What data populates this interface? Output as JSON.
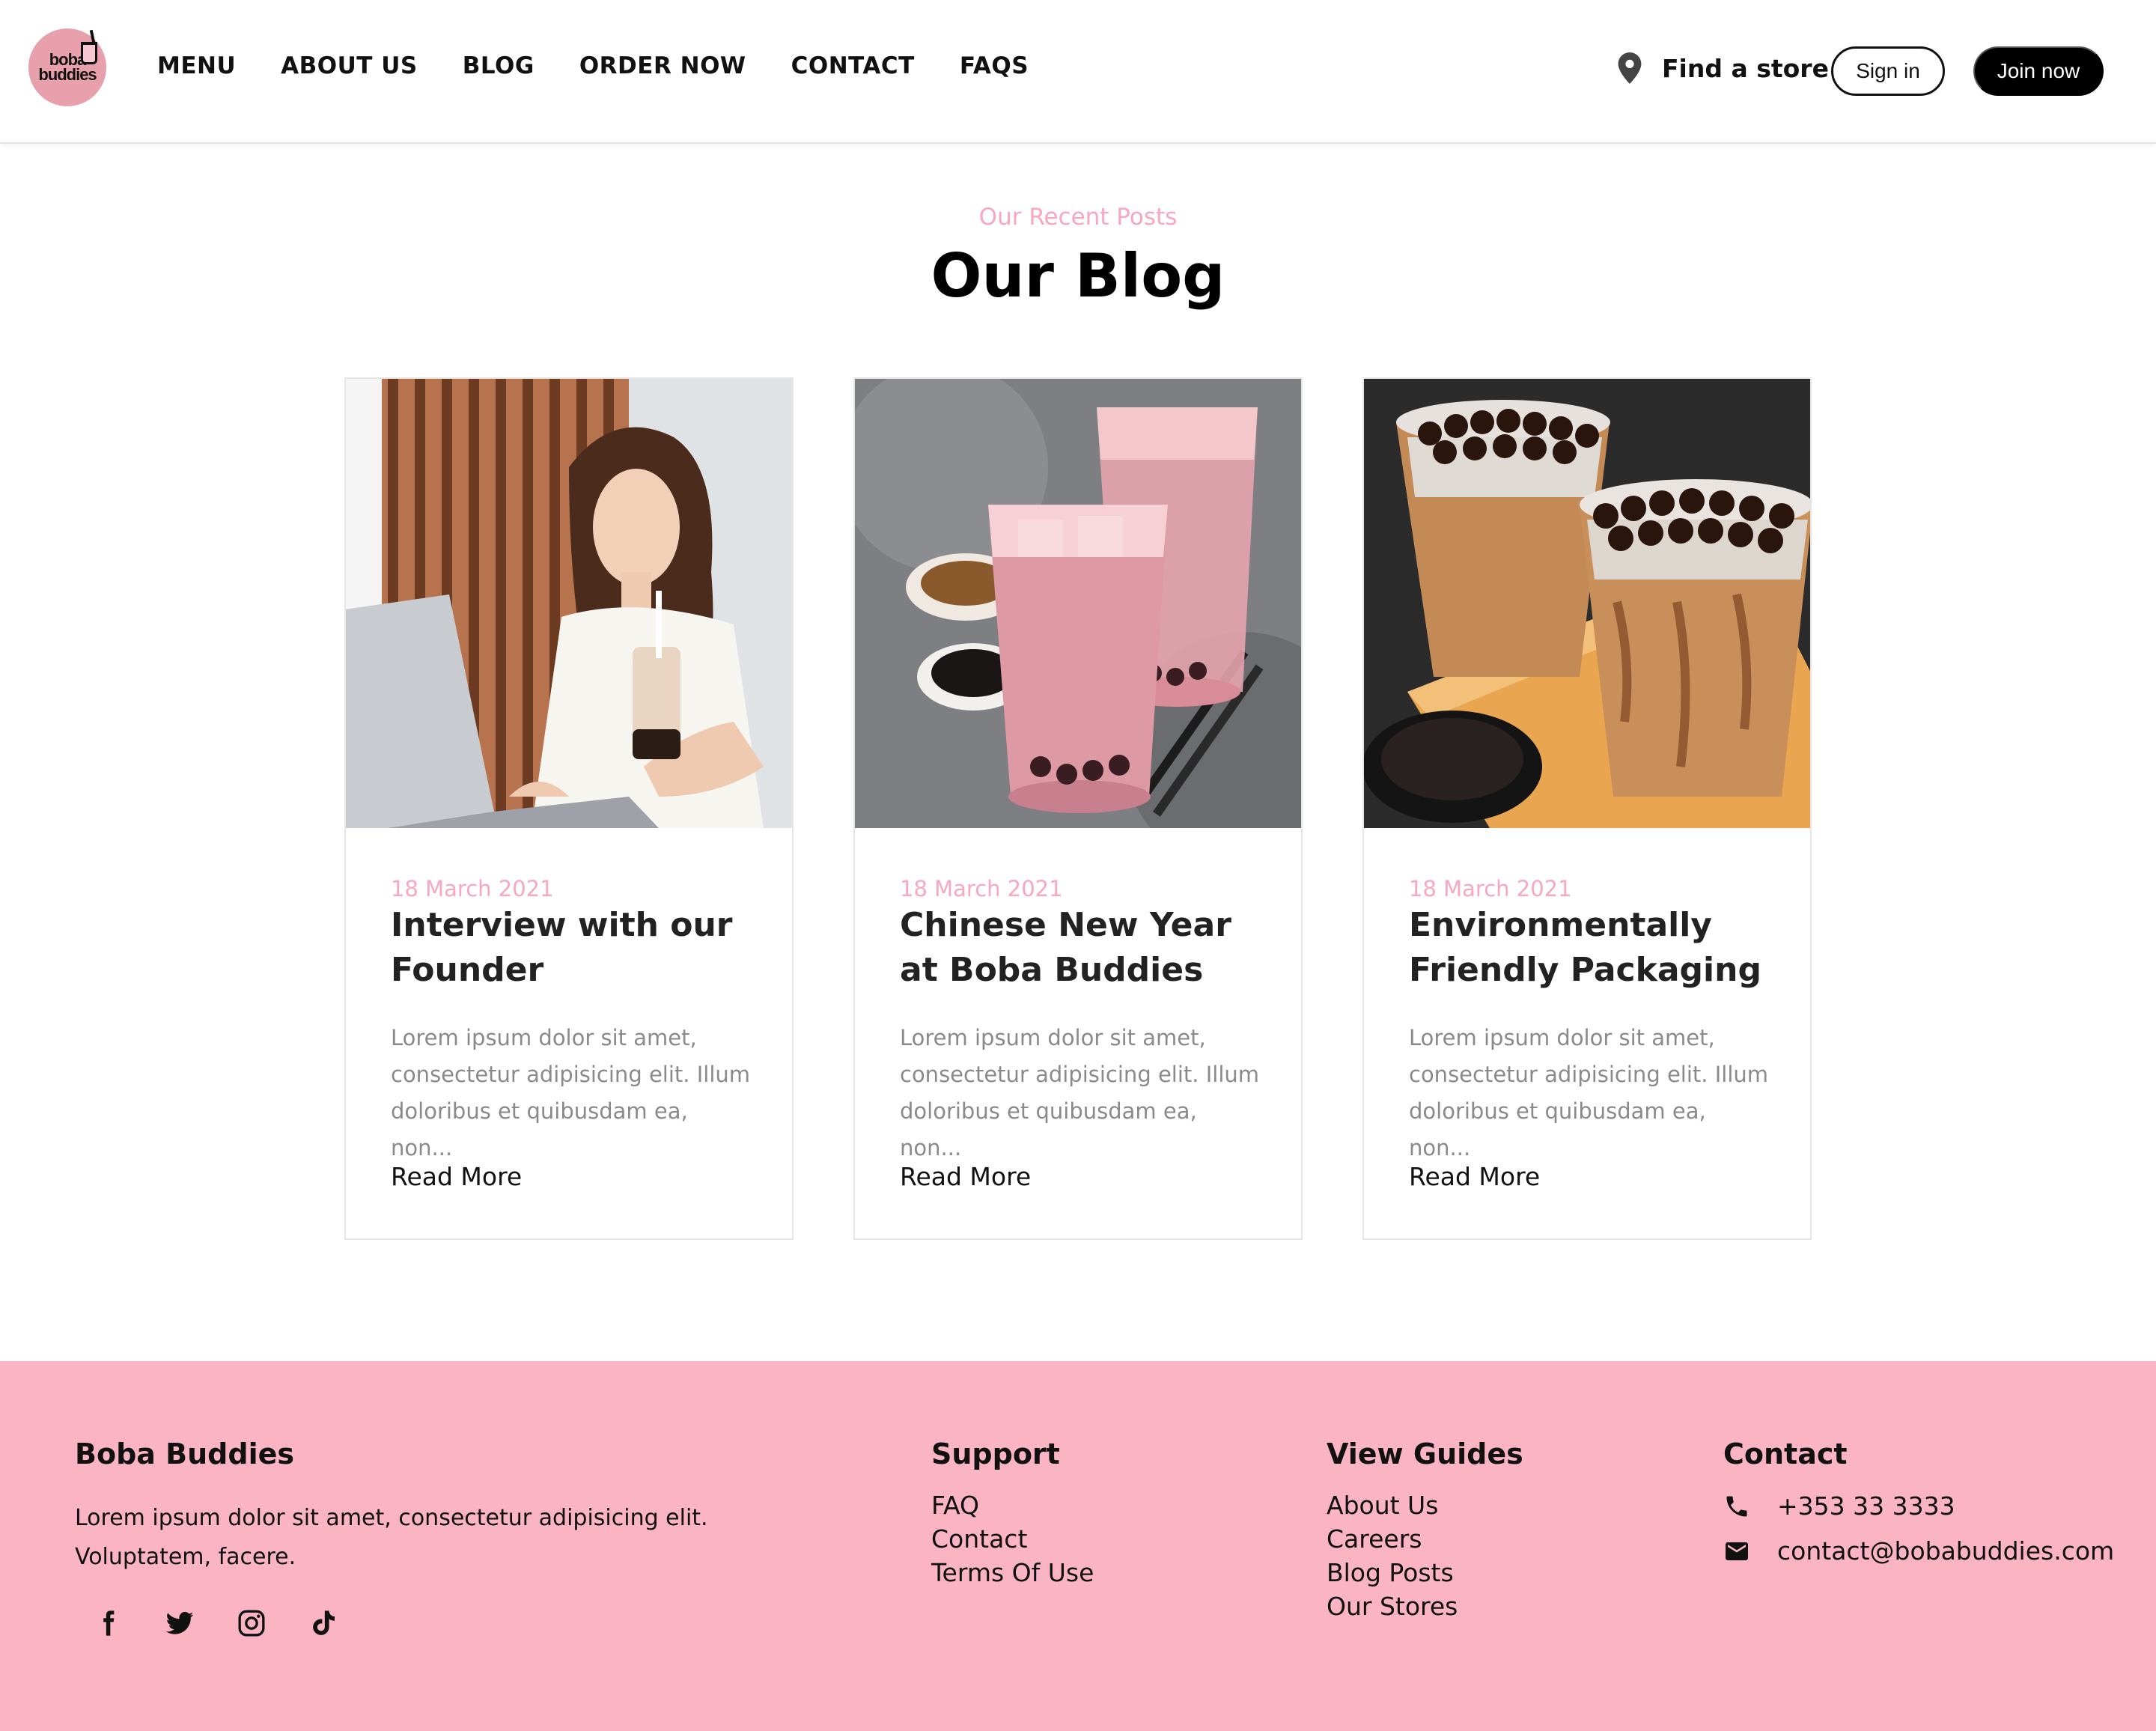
{
  "brand": {
    "logo_line1": "boba",
    "logo_line2": "buddies",
    "colors": {
      "accent_pink": "#f7a8bf",
      "footer_pink": "#fbb4c4",
      "black": "#000000"
    }
  },
  "nav": {
    "items": [
      {
        "label": "MENU"
      },
      {
        "label": "ABOUT US"
      },
      {
        "label": "BLOG"
      },
      {
        "label": "ORDER NOW"
      },
      {
        "label": "CONTACT"
      },
      {
        "label": "FAQS"
      }
    ],
    "find_store": "Find a store",
    "sign_in": "Sign in",
    "join_now": "Join now"
  },
  "blog": {
    "eyebrow": "Our Recent Posts",
    "title": "Our Blog",
    "posts": [
      {
        "date": "18 March 2021",
        "title": "Interview with our Founder",
        "excerpt": "Lorem ipsum dolor sit amet, consectetur adipisicing elit. Illum doloribus et quibusdam ea, non...",
        "read_more": "Read More",
        "image": "woman-with-bubble-tea-photo"
      },
      {
        "date": "18 March 2021",
        "title": "Chinese New Year at Boba Buddies",
        "excerpt": "Lorem ipsum dolor sit amet, consectetur adipisicing elit. Illum doloribus et quibusdam ea, non...",
        "read_more": "Read More",
        "image": "pink-milk-tea-glasses-photo"
      },
      {
        "date": "18 March 2021",
        "title": "Environmentally Friendly Packaging",
        "excerpt": "Lorem ipsum dolor sit amet, consectetur adipisicing elit. Illum doloribus et quibusdam ea, non...",
        "read_more": "Read More",
        "image": "brown-sugar-boba-cups-photo"
      }
    ]
  },
  "footer": {
    "brand_heading": "Boba Buddies",
    "description": "Lorem ipsum dolor sit amet, consectetur adipisicing elit. Voluptatem, facere.",
    "social_icons": [
      "facebook-icon",
      "twitter-icon",
      "instagram-icon",
      "tiktok-icon"
    ],
    "support": {
      "heading": "Support",
      "links": [
        "FAQ",
        "Contact",
        "Terms Of Use"
      ]
    },
    "guides": {
      "heading": "View Guides",
      "links": [
        "About Us",
        "Careers",
        "Blog Posts",
        "Our Stores"
      ]
    },
    "contact": {
      "heading": "Contact",
      "phone": "+353 33 3333",
      "email": "contact@bobabuddies.com"
    }
  }
}
